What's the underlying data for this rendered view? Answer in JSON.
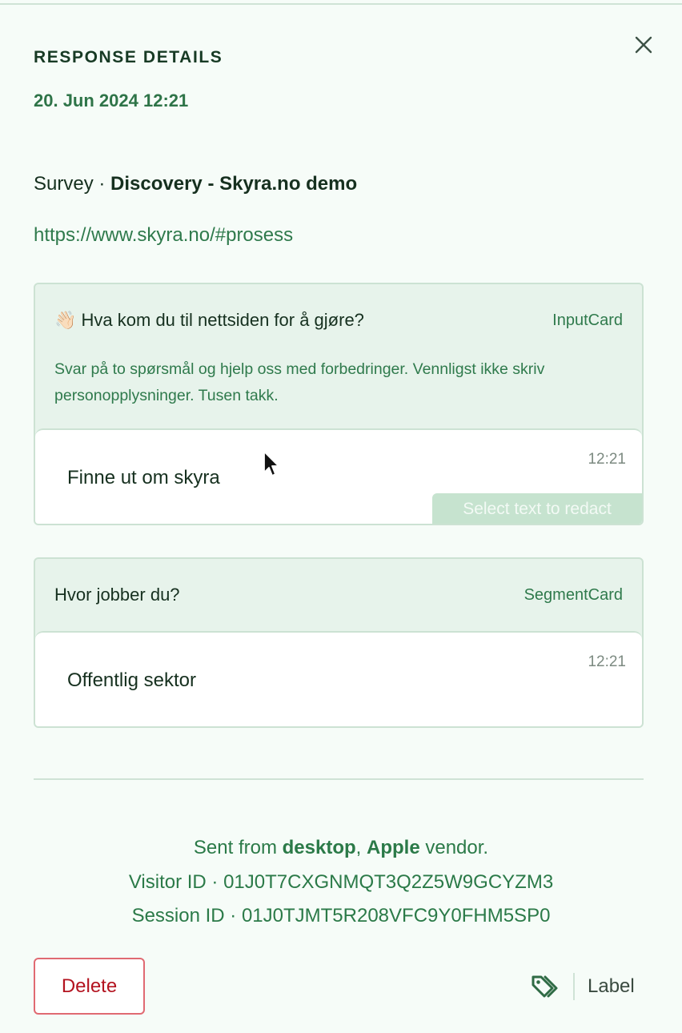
{
  "panel": {
    "heading": "RESPONSE DETAILS",
    "date": "20. Jun 2024 12:21",
    "close_icon": "close-icon"
  },
  "survey": {
    "prefix": "Survey · ",
    "name": "Discovery - Skyra.no demo",
    "url": "https://www.skyra.no/#prosess"
  },
  "cards": [
    {
      "emoji": "👋🏻",
      "question": "Hva kom du til nettsiden for å gjøre?",
      "type": "InputCard",
      "description": "Svar på to spørsmål og hjelp oss med forbedringer. Vennligst ikke skriv personopplysninger. Tusen takk.",
      "answer": "Finne ut om skyra",
      "time": "12:21",
      "redact_label": "Select text to redact"
    },
    {
      "question": "Hvor jobber du?",
      "type": "SegmentCard",
      "answer": "Offentlig sektor",
      "time": "12:21"
    }
  ],
  "meta": {
    "sent_prefix": "Sent from ",
    "device": "desktop",
    "sep": ", ",
    "vendor": "Apple",
    "sent_suffix": " vendor.",
    "visitor_line": "Visitor ID · 01J0T7CXGNMQT3Q2Z5W9GCYZM3",
    "session_line": "Session ID · 01J0TJMT5R208VFC9Y0FHM5SP0"
  },
  "actions": {
    "delete_label": "Delete",
    "label_label": "Label",
    "tag_icon": "tag-icon"
  },
  "colors": {
    "background": "#f6fcf8",
    "accent_green": "#2e7448",
    "card_header": "#e7f3eb",
    "delete_red": "#b3131f"
  }
}
